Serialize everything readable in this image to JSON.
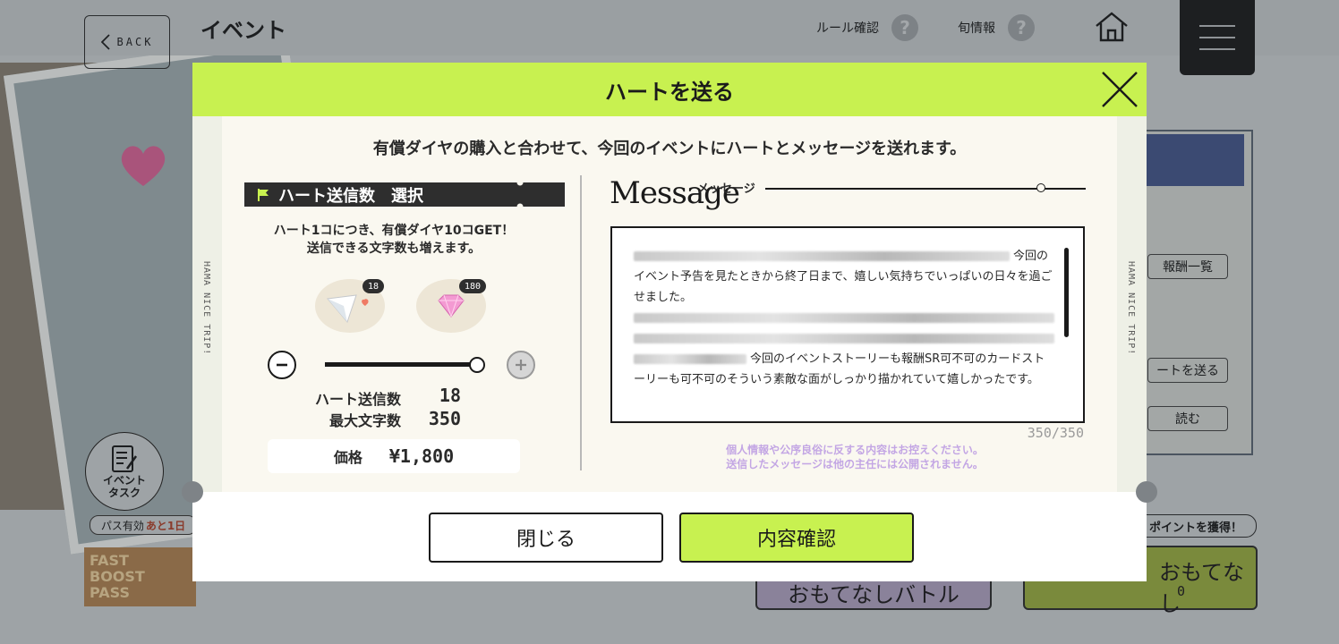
{
  "background": {
    "back_label": "BACK",
    "page_title": "イベント",
    "rule_label": "ルール確認",
    "season_label": "旬情報",
    "help_mark": "?",
    "right_panel_buttons": [
      "報酬一覧",
      "ートを送る",
      "読む"
    ],
    "event_task_label": [
      "イベント",
      "タスク"
    ],
    "pass_label": "パス有効",
    "pass_remaining": "あと1日",
    "fast_label": "FAST BOOST PASS",
    "points_label": "ポイントを獲得！",
    "battle1_label": "おもてなしバトル",
    "battle2_label": "おもてなし",
    "battle2_count": "0"
  },
  "modal": {
    "title": "ハートを送る",
    "side_text": "HAMA NICE TRIP!",
    "lead": "有償ダイヤの購入と合わせて、今回のイベントにハートとメッセージを送れます。",
    "selection": {
      "header": "ハート送信数　選択",
      "desc_line1": "ハート1コにつき、有償ダイヤ10コGET！",
      "desc_line2": "送信できる文字数も増えます。",
      "heart_badge": "18",
      "diamond_badge": "180",
      "send_count_label": "ハート送信数",
      "send_count_value": "18",
      "max_chars_label": "最大文字数",
      "max_chars_value": "350",
      "price_label": "価格",
      "price_value": "¥1,800",
      "slider_fraction": 1.0
    },
    "message": {
      "title": "Message",
      "subtitle": "メッセージ",
      "text_part1": "今回の",
      "text_part2": "イベント予告を見たときから終了日まで、嬉しい気持ちでいっぱいの日々を過ごせました。",
      "text_part3": "今回のイベントストーリーも報酬SR可不可のカードストーリーも可不可のそういう素敵な面がしっかり描かれていて嬉しかったです。",
      "counter": "350/350",
      "note_line1": "個人情報や公序良俗に反する内容はお控えください。",
      "note_line2": "送信したメッセージは他の主任には公開されません。"
    },
    "buttons": {
      "close": "閉じる",
      "confirm": "内容確認"
    },
    "colors": {
      "accent": "#c8f150",
      "note": "#c3a6e4"
    }
  }
}
